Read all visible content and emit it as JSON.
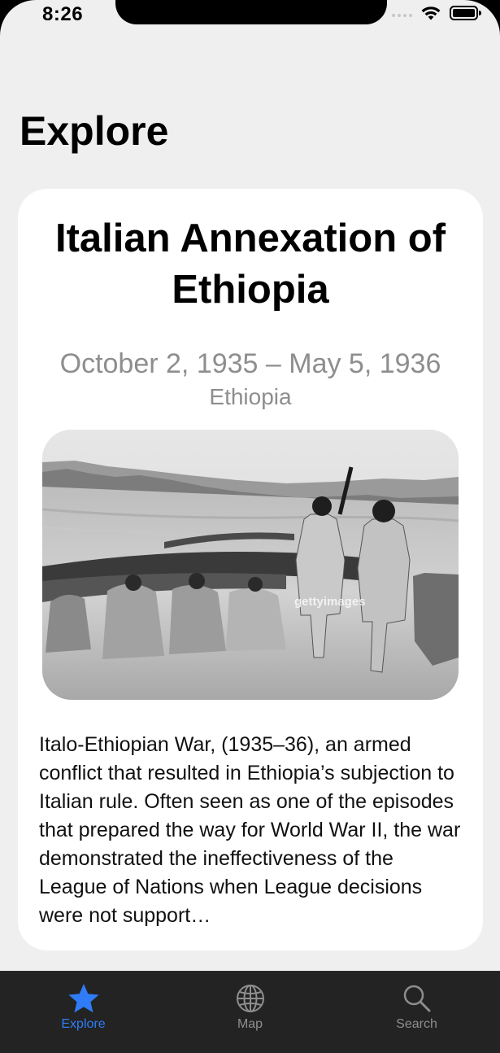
{
  "status_bar": {
    "time": "8:26"
  },
  "header": {
    "title": "Explore"
  },
  "event": {
    "title": "Italian Annexation of Ethiopia",
    "dates": "October 2, 1935 – May 5, 1936",
    "location": "Ethiopia",
    "image_watermark": "gettyimages",
    "description": "Italo-Ethiopian War, (1935–36), an armed conflict that resulted in Ethiopia’s subjection to Italian rule. Often seen as one of the episodes that prepared the way for World War II, the war demonstrated the ineffectiveness of the League of Nations when League decisions were not support…"
  },
  "tab_bar": {
    "items": [
      {
        "label": "Explore",
        "icon": "star-icon",
        "active": true
      },
      {
        "label": "Map",
        "icon": "globe-icon",
        "active": false
      },
      {
        "label": "Search",
        "icon": "magnifying-glass-icon",
        "active": false
      }
    ]
  },
  "colors": {
    "accent": "#2f7cf6",
    "background": "#efefef",
    "card": "#ffffff",
    "secondary_text": "#8e8e8e",
    "tab_bar": "#232323"
  }
}
